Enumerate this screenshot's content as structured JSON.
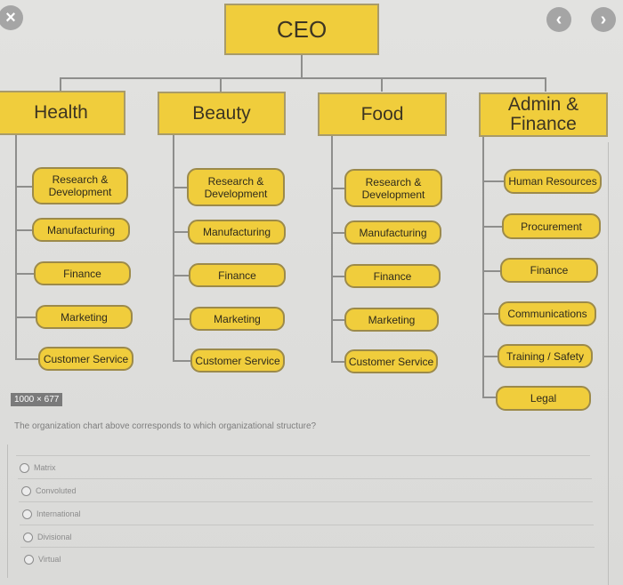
{
  "controls": {
    "close_icon": "×",
    "prev_icon": "‹",
    "next_icon": "›"
  },
  "colors": {
    "box_fill": "#f0cd3c",
    "box_border": "#a89b6a",
    "connector": "#8e8e8c",
    "background": "#dcdcda"
  },
  "org_chart": {
    "root": "CEO",
    "divisions": [
      {
        "name": "Health",
        "units": [
          "Research & Development",
          "Manufacturing",
          "Finance",
          "Marketing",
          "Customer Service"
        ]
      },
      {
        "name": "Beauty",
        "units": [
          "Research & Development",
          "Manufacturing",
          "Finance",
          "Marketing",
          "Customer Service"
        ]
      },
      {
        "name": "Food",
        "units": [
          "Research & Development",
          "Manufacturing",
          "Finance",
          "Marketing",
          "Customer Service"
        ]
      },
      {
        "name": "Admin & Finance",
        "units": [
          "Human Resources",
          "Procurement",
          "Finance",
          "Communications",
          "Training / Safety",
          "Legal"
        ]
      }
    ]
  },
  "image_size_badge": "1000 × 677",
  "quiz": {
    "question": "The organization chart above corresponds to which organizational structure?",
    "options": [
      "Matrix",
      "Convoluted",
      "International",
      "Divisional",
      "Virtual"
    ]
  }
}
